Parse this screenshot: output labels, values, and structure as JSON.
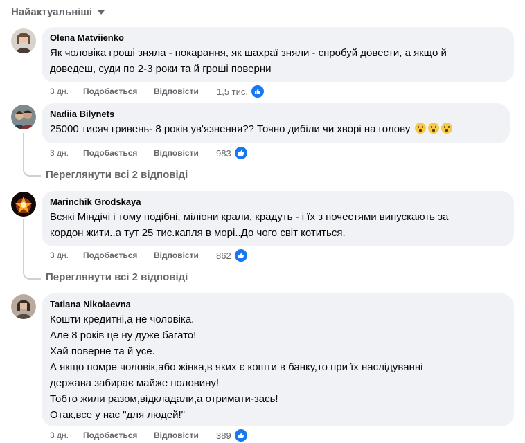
{
  "sort": {
    "label": "Найактуальніші"
  },
  "action_labels": {
    "like": "Подобається",
    "reply": "Відповісти"
  },
  "comments": [
    {
      "author": "Olena Matviienko",
      "lines": [
        "Як чоловіка гроші зняла - покарання, як шахраї зняли - спробуй довести, а якщо й",
        "доведеш, суди по 2-3 роки та й гроші поверни"
      ],
      "time": "3 дн.",
      "reactions": "1,5 тис."
    },
    {
      "author": "Nadiia Bilynets",
      "lines": [
        "25000 тисяч гривень- 8 років ув'язнення?? Точно дибіли чи хворі на голову"
      ],
      "time": "3 дн.",
      "reactions": "983",
      "view_replies": "Переглянути всі 2 відповіді"
    },
    {
      "author": "Marinchik Grodskaya",
      "lines": [
        "Всякі Міндічі і тому подібні, мілioни крали, крадуть - і їх з почестями випускають за",
        "кордон жити..а тут 25 тис.капля в морі..До чого світ котиться."
      ],
      "time": "3 дн.",
      "reactions": "862",
      "view_replies": "Переглянути всі 2 відповіді"
    },
    {
      "author": "Tatiana Nikolaevna",
      "lines": [
        "Кошти кредитні,а не чоловіка.",
        "Але 8 років це ну дуже багато!",
        "Хай поверне та й усе.",
        "А якщо помре чоловік,або жінка,в яких є кошти в банку,то при їх наслідуванні",
        "держава забирає майже половину!",
        "Тобто жили разом,відкладали,а отримати-зась!",
        "Отак,все у нас \"для людей!\""
      ],
      "time": "3 дн.",
      "reactions": "389"
    }
  ],
  "colors": {
    "bubble": "#f0f2f5",
    "muted": "#65676b",
    "like_blue": "#1877f2"
  }
}
